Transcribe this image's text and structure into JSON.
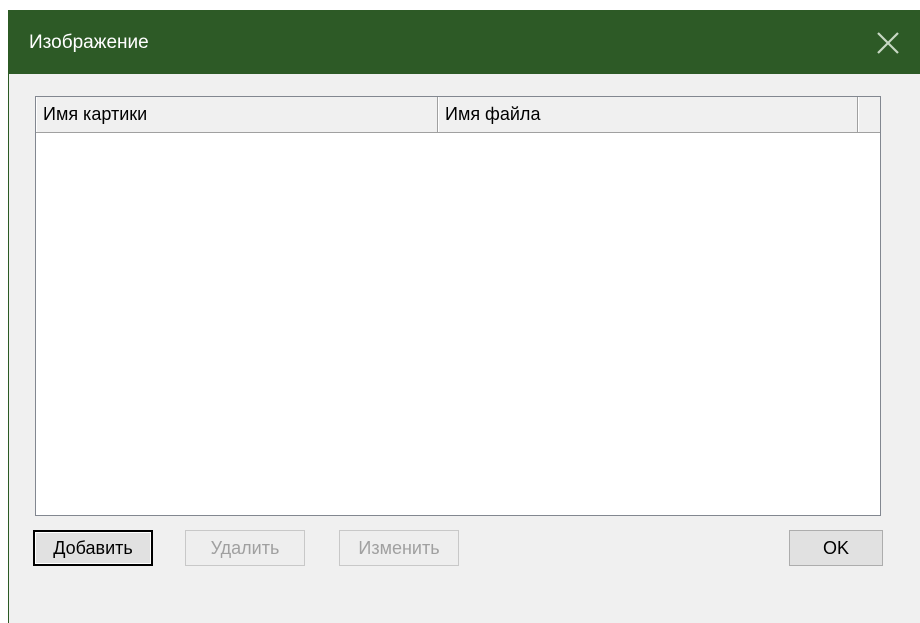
{
  "window": {
    "title": "Изображение"
  },
  "list": {
    "columns": [
      "Имя картики",
      "Имя файла",
      ""
    ],
    "rows": []
  },
  "buttons": {
    "add": "Добавить",
    "delete": "Удалить",
    "edit": "Изменить",
    "ok": "OK"
  },
  "colors": {
    "titlebar": "#2d5a26",
    "window_bg": "#f0f0f0"
  },
  "icons": {
    "close": "close-icon"
  }
}
